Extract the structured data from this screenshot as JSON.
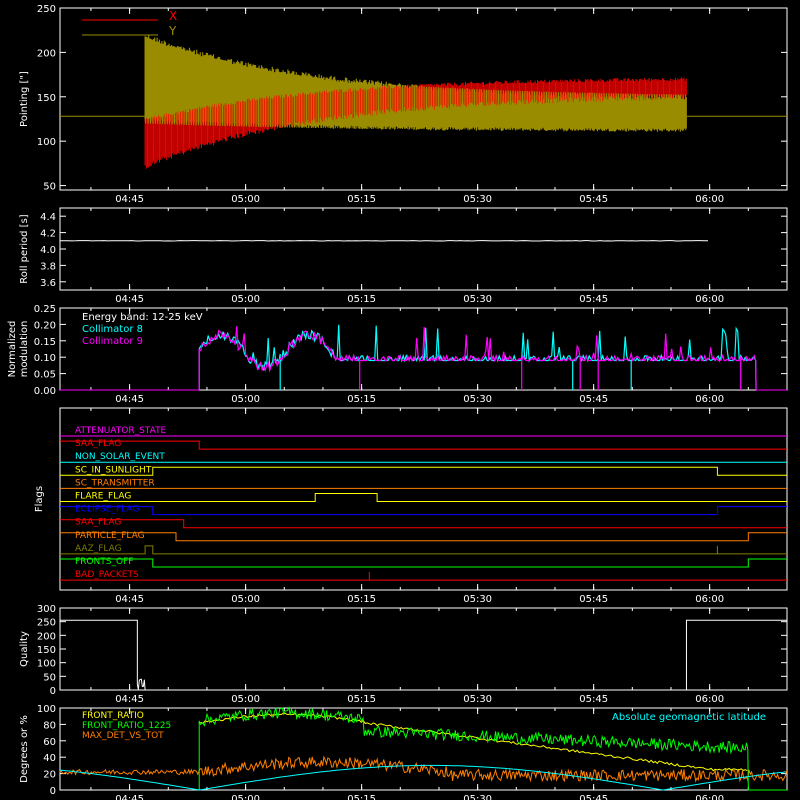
{
  "x_time_labels": [
    "04:45",
    "05:00",
    "05:15",
    "05:30",
    "05:45",
    "06:00"
  ],
  "chart_data": [
    {
      "type": "line",
      "panel": "pointing",
      "ylabel": "Pointing [\"]",
      "ylim": [
        45,
        250
      ],
      "yticks": [
        50,
        100,
        150,
        200,
        250
      ],
      "legend_placement": "top-left",
      "series": [
        {
          "name": "X",
          "color": "#ff0000",
          "baseline": 128,
          "start": "04:47",
          "end": "05:57",
          "envelope_start": [
            65,
            120
          ],
          "envelope_settle": [
            150,
            172
          ],
          "description_level": 160
        },
        {
          "name": "Y",
          "color": "#9a8c00",
          "baseline": 128,
          "start": "04:47",
          "end": "05:57",
          "envelope_start": [
            122,
            222
          ],
          "envelope_settle": [
            110,
            150
          ]
        }
      ]
    },
    {
      "type": "line",
      "panel": "roll",
      "ylabel": "Roll period [s]",
      "ylim": [
        3.5,
        4.5
      ],
      "yticks": [
        3.6,
        3.8,
        4.0,
        4.2,
        4.4
      ],
      "series": [
        {
          "name": "",
          "color": "#ffffff",
          "value": 4.1
        }
      ]
    },
    {
      "type": "line",
      "panel": "modulation",
      "ylabel": "Normalized modulation",
      "ylim": [
        0,
        0.25
      ],
      "yticks": [
        0.0,
        0.05,
        0.1,
        0.15,
        0.2,
        0.25
      ],
      "annotation": "Energy band: 12-25 keV",
      "series": [
        {
          "name": "Collimator 8",
          "color": "#00ffff",
          "start": "04:54",
          "end": "06:06",
          "level": 0.09
        },
        {
          "name": "Collimator 9",
          "color": "#ff00ff",
          "start": "04:54",
          "end": "06:06",
          "level": 0.09
        }
      ]
    },
    {
      "type": "line",
      "panel": "flags",
      "ylabel": "Flags",
      "series": [
        {
          "name": "ATTENUATOR_STATE",
          "color": "#ff00ff",
          "segments": [
            [
              "04:36",
              0
            ],
            [
              "06:10",
              0
            ]
          ]
        },
        {
          "name": "SAA_FLAG",
          "color": "#ff0000",
          "segments": [
            [
              "04:36",
              1
            ],
            [
              "04:54",
              1
            ],
            [
              "04:54",
              0
            ],
            [
              "06:10",
              0
            ]
          ]
        },
        {
          "name": "NON_SOLAR_EVENT",
          "color": "#00ffff",
          "segments": [
            [
              "04:36",
              0
            ],
            [
              "06:10",
              0
            ]
          ]
        },
        {
          "name": "SC_IN_SUNLIGHT",
          "color": "#ffff00",
          "segments": [
            [
              "04:36",
              0
            ],
            [
              "04:48",
              0
            ],
            [
              "04:48",
              1
            ],
            [
              "06:01",
              1
            ],
            [
              "06:01",
              0
            ],
            [
              "06:10",
              0
            ]
          ]
        },
        {
          "name": "SC_TRANSMITTER",
          "color": "#ff7f00",
          "segments": [
            [
              "04:36",
              0
            ],
            [
              "06:10",
              0
            ]
          ]
        },
        {
          "name": "FLARE_FLAG",
          "color": "#ffff00",
          "segments": [
            [
              "04:36",
              0
            ],
            [
              "05:09",
              0
            ],
            [
              "05:09",
              1
            ],
            [
              "05:17",
              1
            ],
            [
              "05:17",
              0
            ],
            [
              "06:10",
              0
            ]
          ]
        },
        {
          "name": "ECLIPSE_FLAG",
          "color": "#0000ff",
          "segments": [
            [
              "04:36",
              1
            ],
            [
              "04:48",
              1
            ],
            [
              "04:48",
              0
            ],
            [
              "06:01",
              0
            ],
            [
              "06:01",
              1
            ],
            [
              "06:10",
              1
            ]
          ]
        },
        {
          "name": "SAA_FLAG",
          "color": "#ff0000",
          "segments": [
            [
              "04:36",
              1
            ],
            [
              "04:52",
              1
            ],
            [
              "04:52",
              0
            ],
            [
              "06:10",
              0
            ]
          ]
        },
        {
          "name": "PARTICLE_FLAG",
          "color": "#ff7f00",
          "segments": [
            [
              "04:36",
              1
            ],
            [
              "04:51",
              1
            ],
            [
              "04:51",
              0
            ],
            [
              "06:05",
              0
            ],
            [
              "06:05",
              1
            ],
            [
              "06:10",
              1
            ]
          ]
        },
        {
          "name": "AAZ_FLAG",
          "color": "#7f7f00",
          "segments": [
            [
              "04:36",
              0
            ],
            [
              "04:47",
              0
            ],
            [
              "04:47",
              1
            ],
            [
              "04:48",
              1
            ],
            [
              "04:48",
              0
            ],
            [
              "06:01",
              0
            ],
            [
              "06:01",
              1
            ],
            [
              "06:01",
              0
            ],
            [
              "06:10",
              0
            ]
          ]
        },
        {
          "name": "FRONTS_OFF",
          "color": "#00ff00",
          "segments": [
            [
              "04:36",
              1
            ],
            [
              "04:48",
              1
            ],
            [
              "04:48",
              0
            ],
            [
              "06:05",
              0
            ],
            [
              "06:05",
              1
            ],
            [
              "06:10",
              1
            ]
          ]
        },
        {
          "name": "BAD_PACKETS",
          "color": "#ff0000",
          "segments": [
            [
              "04:36",
              0
            ],
            [
              "06:10",
              0
            ]
          ]
        }
      ]
    },
    {
      "type": "line",
      "panel": "quality",
      "ylabel": "Quality",
      "ylim": [
        0,
        300
      ],
      "yticks": [
        0,
        50,
        100,
        150,
        200,
        250,
        300
      ],
      "series": [
        {
          "name": "",
          "color": "#ffffff",
          "points": [
            [
              "04:36",
              255
            ],
            [
              "04:46",
              255
            ],
            [
              "04:46",
              70
            ],
            [
              "04:47",
              0
            ],
            [
              "05:57",
              0
            ],
            [
              "05:57",
              255
            ],
            [
              "06:10",
              255
            ]
          ]
        }
      ]
    },
    {
      "type": "line",
      "panel": "ratio",
      "ylabel": "Degrees or %",
      "ylim": [
        0,
        100
      ],
      "yticks": [
        0,
        20,
        40,
        60,
        80,
        100
      ],
      "annotation": "Absolute geomagnetic latitude",
      "series": [
        {
          "name": "FRONT_RATIO",
          "color": "#ffff00",
          "start": "04:54",
          "end": "06:05"
        },
        {
          "name": "FRONT_RATIO_1225",
          "color": "#00ff00",
          "start": "04:54",
          "end": "06:05"
        },
        {
          "name": "MAX_DET_VS_TOT",
          "color": "#ff7f00",
          "start": "04:36",
          "end": "06:10"
        },
        {
          "name": "Absolute geomagnetic latitude",
          "color": "#00ffff",
          "points": [
            [
              "04:36",
              30
            ],
            [
              "04:54",
              0
            ],
            [
              "05:20",
              30
            ],
            [
              "05:50",
              0
            ],
            [
              "06:10",
              30
            ]
          ]
        }
      ]
    }
  ],
  "colors": {
    "axis": "#ffffff",
    "background": "#000000"
  }
}
